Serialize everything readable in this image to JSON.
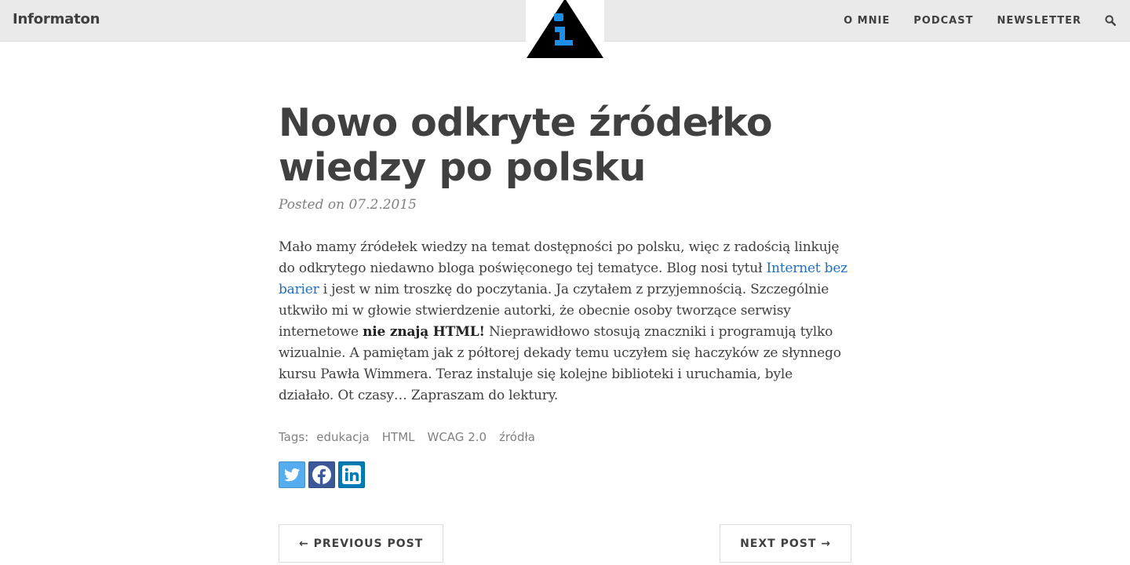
{
  "site": {
    "brand": "Informaton"
  },
  "nav": {
    "items": [
      {
        "label": "O MNIE"
      },
      {
        "label": "PODCAST"
      },
      {
        "label": "NEWSLETTER"
      }
    ],
    "search_icon": "search-icon"
  },
  "post": {
    "title_line1": "Nowo odkryte źródełko",
    "title_line2": "wiedzy po polsku",
    "meta": "Posted on 07.2.2015",
    "body": {
      "part1": "Mało mamy źródełek wiedzy na temat dostępności po polsku, więc z radością linkuję do odkrytego niedawno bloga poświęconego tej tematyce. Blog nosi tytuł ",
      "link_text": "Internet bez barier",
      "part2": " i jest w nim troszkę do poczytania. Ja czytałem z przyjemnością. Szczególnie utkwiło mi w głowie stwierdzenie autorki, że obecnie osoby tworzące serwisy internetowe ",
      "strong_text": "nie znają HTML!",
      "part3": " Nieprawidłowo stosują znaczniki i programują tylko wizualnie. A pamiętam jak z półtorej dekady temu uczyłem się haczyków ze słynnego kursu Pawła Wimmera. Teraz instaluje się kolejne biblioteki i uruchamia, byle działało. Ot czasy… Zapraszam do lektury."
    },
    "tags_label": "Tags:",
    "tags": [
      "edukacja",
      "HTML",
      "WCAG 2.0",
      "źródła"
    ],
    "share": [
      {
        "icon": "twitter-icon",
        "color": "#55acee"
      },
      {
        "icon": "facebook-icon",
        "color": "#3b5998"
      },
      {
        "icon": "linkedin-icon",
        "color": "#007bb5"
      }
    ]
  },
  "pager": {
    "prev_label": "← PREVIOUS POST",
    "next_label": "NEXT POST →"
  },
  "colors": {
    "topbar_bg": "#eaeaea",
    "text": "#404040",
    "link": "#1f6fc1",
    "logo_blue": "#1e8ee8"
  }
}
